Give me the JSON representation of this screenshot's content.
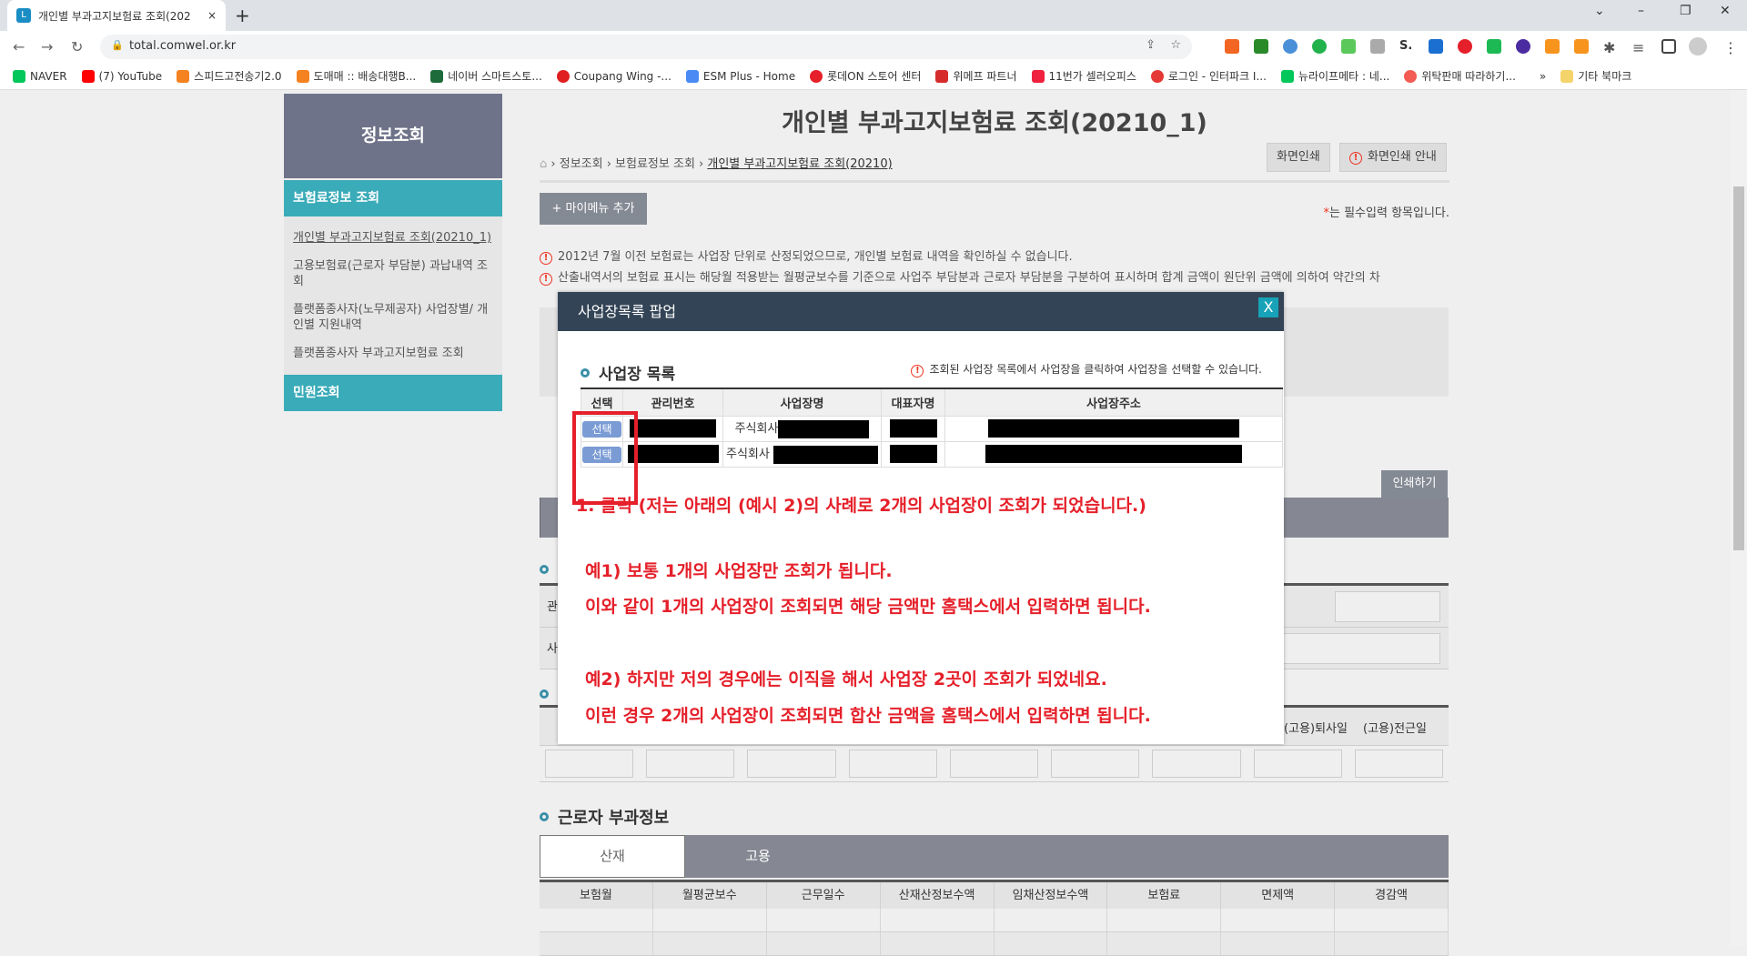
{
  "browser": {
    "tab_title": "개인별 부과고지보험료 조회(202",
    "url": "total.comwel.or.kr",
    "bookmarks": [
      {
        "label": "NAVER",
        "color": "#03c75a"
      },
      {
        "label": "(7) YouTube",
        "color": "#f00"
      },
      {
        "label": "스피드고전송기2.0",
        "color": "#f58220"
      },
      {
        "label": "도매매 :: 배송대행B...",
        "color": "#f58220"
      },
      {
        "label": "네이버 스마트스토...",
        "color": "#1d6b3a"
      },
      {
        "label": "Coupang Wing -...",
        "color": "#e02020"
      },
      {
        "label": "ESM Plus - Home",
        "color": "#4a8af4"
      },
      {
        "label": "롯데ON 스토어 센터",
        "color": "#e5202a"
      },
      {
        "label": "위메프 파트너",
        "color": "#d62c2c"
      },
      {
        "label": "11번가 셀러오피스",
        "color": "#f0213e"
      },
      {
        "label": "로그인 - 인터파크 I...",
        "color": "#e53935"
      },
      {
        "label": "뉴라이프메타 : 네...",
        "color": "#03c75a"
      },
      {
        "label": "위탁판매 따라하기...",
        "color": "#f25c54"
      }
    ],
    "more": "»",
    "other_bookmarks": "기타 북마크"
  },
  "sidebar": {
    "header": "정보조회",
    "category1": "보험료정보 조회",
    "items": [
      "개인별 부과고지보험료 조회(20210_1)",
      "고용보험료(근로자 부담분) 과납내역 조회",
      "플랫폼종사자(노무제공자) 사업장별/ 개인별 지원내역",
      "플랫폼종사자 부과고지보험료 조회"
    ],
    "category2": "민원조회"
  },
  "main": {
    "title": "개인별 부과고지보험료 조회(20210_1)",
    "breadcrumb": [
      "정보조회",
      "보험료정보 조회",
      "개인별 부과고지보험료 조회(20210)"
    ],
    "print_screen": "화면인쇄",
    "print_guide": "화면인쇄 안내",
    "add_mymenu": "+ 마이메뉴 추가",
    "required_note": "는 필수입력 항목입니다.",
    "required_mark": "*",
    "notices": [
      "2012년 7월 이전 보험료는 사업장 단위로 산정되었으므로, 개인별 보험료 내역을 확인하실 수 없습니다.",
      "산출내역서의 보험료 표시는 해당월 적용받는 월평균보수를 기준으로 사업주 부담분과 근로자 부담분을 구분하여 표시하며 합계 금액이 원단위 금액에 의하여 약간의 차"
    ],
    "print_button": "인쇄하기",
    "partial_label1": "관",
    "partial_label2": "사",
    "col_quit": "(고용)퇴사일",
    "col_transfer": "(고용)전근일",
    "section3": "근로자 부과정보",
    "tabs": [
      "산재",
      "고용"
    ],
    "columns": [
      "보험월",
      "월평균보수",
      "근무일수",
      "산재산정보수액",
      "임채산정보수액",
      "보험료",
      "면제액",
      "경감액"
    ]
  },
  "popup": {
    "title": "사업장목록 팝업",
    "close": "X",
    "section": "사업장 목록",
    "note": "조회된 사업장 목록에서 사업장을 클릭하여 사업장을 선택할 수 있습니다.",
    "columns": [
      "선택",
      "관리번호",
      "사업장명",
      "대표자명",
      "사업장주소"
    ],
    "rows": [
      {
        "select": "선택",
        "name_prefix": "주식회사"
      },
      {
        "select": "선택",
        "name_prefix": "주식회사"
      }
    ],
    "annotations": [
      "1. 클릭 (저는 아래의 (예시 2)의 사례로 2개의 사업장이 조회가 되었습니다.)",
      "예1) 보통 1개의 사업장만 조회가 됩니다.",
      "이와 같이 1개의 사업장이 조회되면 해당 금액만 홈택스에서 입력하면 됩니다.",
      "예2) 하지만 저의 경우에는 이직을 해서 사업장 2곳이 조회가 되었네요.",
      "이런 경우 2개의 사업장이 조회되면 합산 금액을 홈택스에서 입력하면 됩니다."
    ]
  },
  "colors": {
    "teal": "#3aabb8",
    "popup_header": "#334456",
    "annotation": "#e5202a"
  }
}
